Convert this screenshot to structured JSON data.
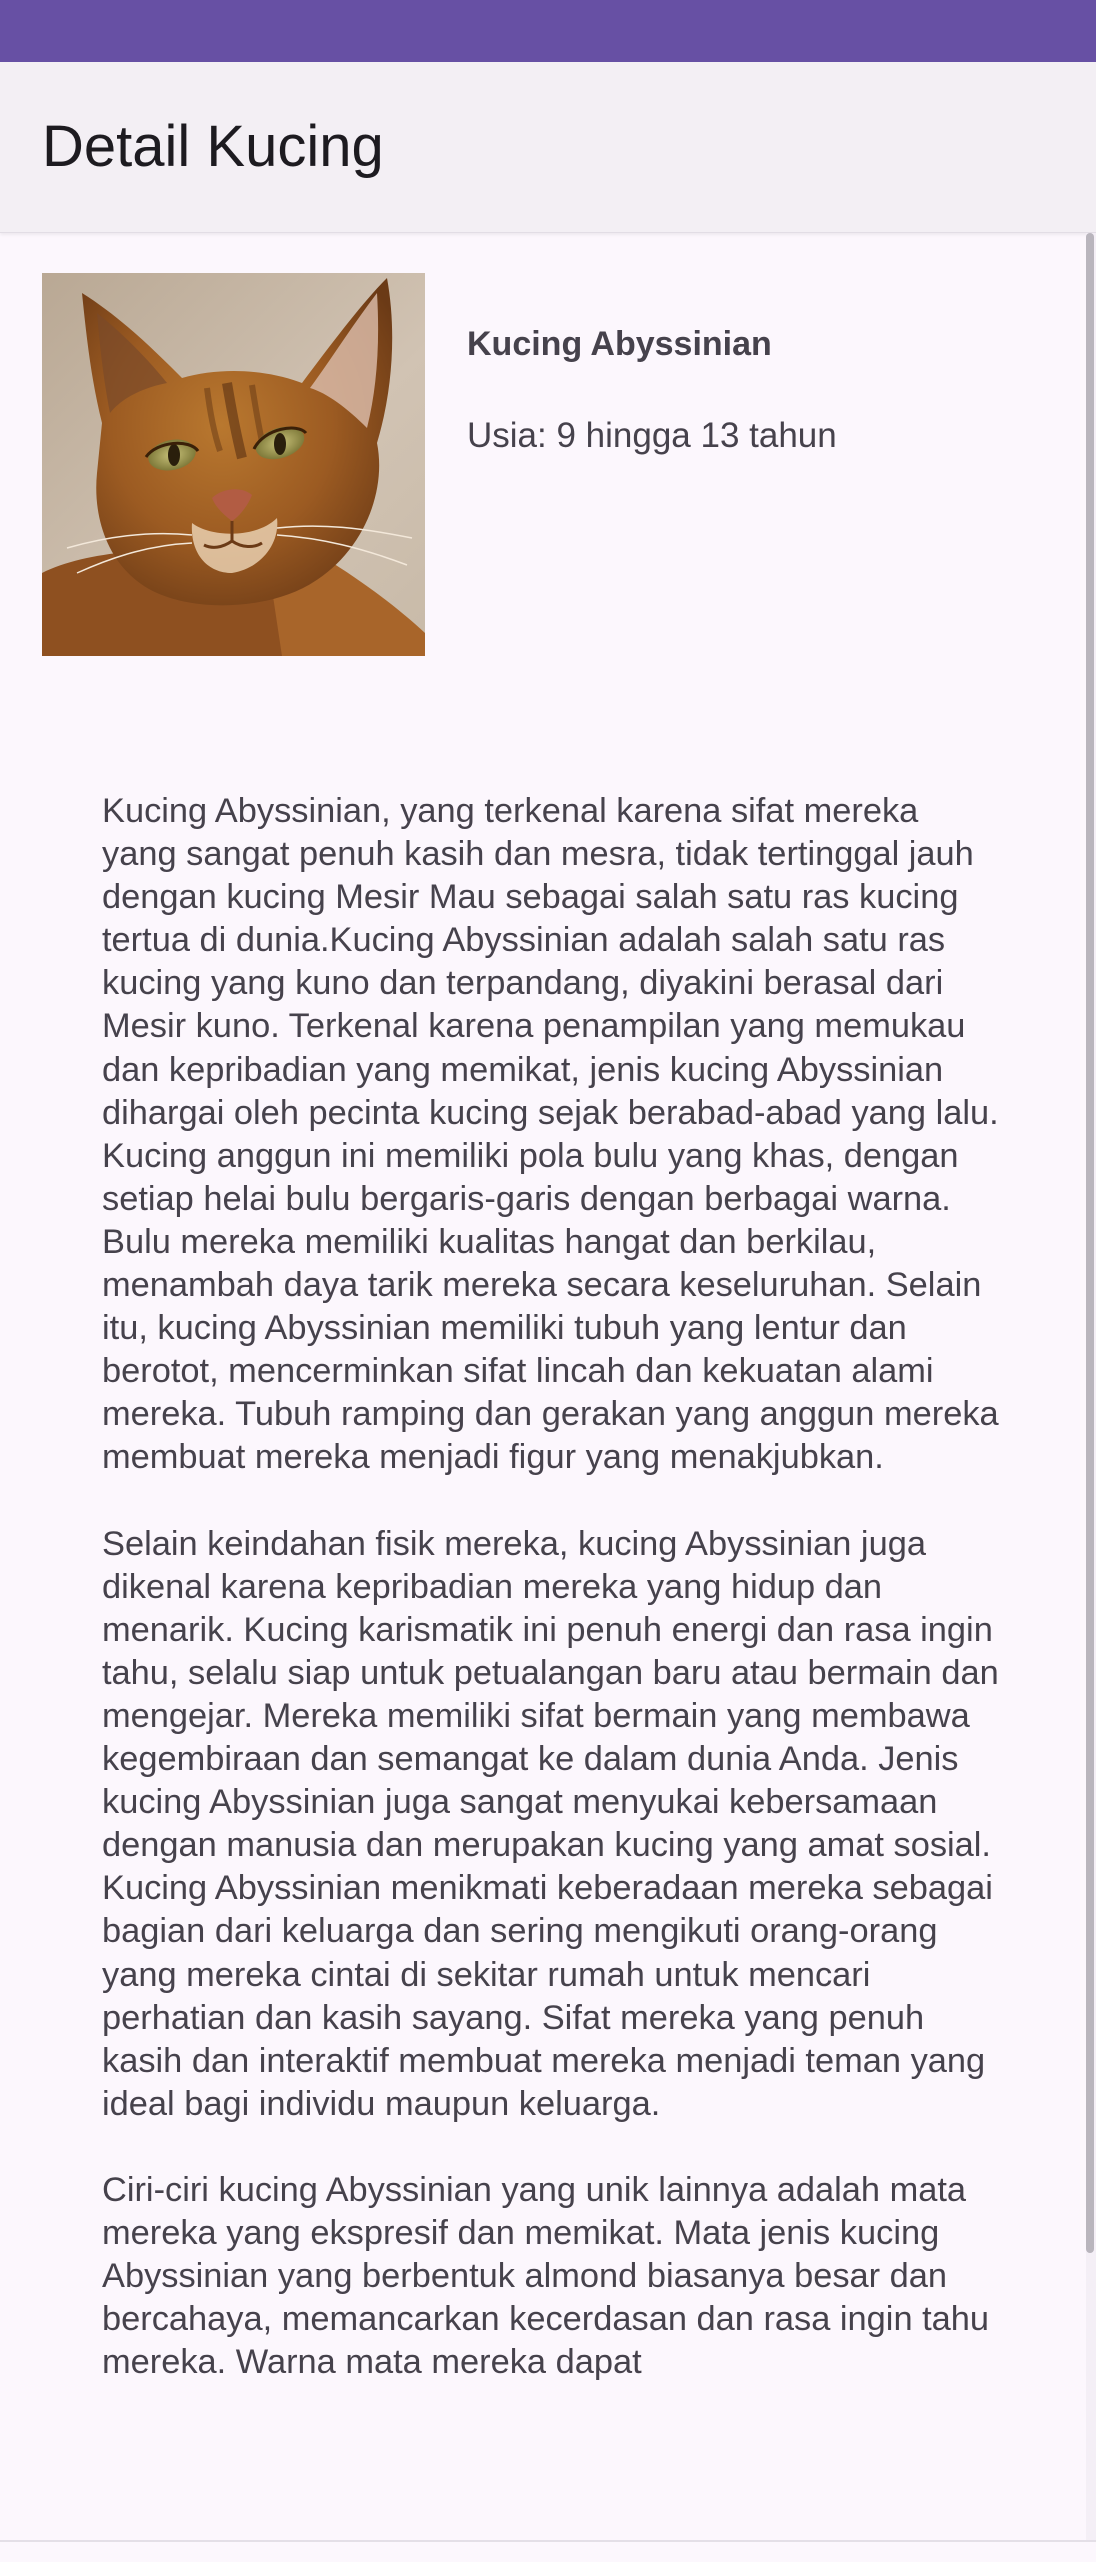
{
  "colors": {
    "status_bar": "#6750a4",
    "app_bar": "#f3eff4",
    "background": "#fcf7fd",
    "text": "#46424c"
  },
  "app_bar": {
    "title": "Detail Kucing"
  },
  "cat": {
    "image_icon": "abyssinian-cat-photo",
    "name": "Kucing Abyssinian",
    "age": "Usia: 9 hingga 13 tahun"
  },
  "description": {
    "paragraphs": [
      "Kucing Abyssinian, yang terkenal karena sifat mereka yang sangat penuh kasih dan mesra, tidak tertinggal jauh dengan kucing Mesir Mau sebagai salah satu ras kucing tertua di dunia.Kucing Abyssinian adalah salah satu ras kucing yang kuno dan terpandang, diyakini berasal dari Mesir kuno. Terkenal karena penampilan yang memukau dan kepribadian yang memikat, jenis kucing Abyssinian dihargai oleh pecinta kucing sejak berabad-abad yang lalu. Kucing anggun ini memiliki pola bulu yang khas, dengan setiap helai bulu bergaris-garis dengan berbagai warna. Bulu mereka memiliki kualitas hangat dan berkilau, menambah daya tarik mereka secara keseluruhan. Selain itu, kucing Abyssinian memiliki tubuh yang lentur dan berotot, mencerminkan sifat lincah dan kekuatan alami mereka. Tubuh ramping dan gerakan yang anggun mereka membuat mereka menjadi figur yang menakjubkan.",
      "Selain keindahan fisik mereka, kucing Abyssinian juga dikenal karena kepribadian mereka yang hidup dan menarik. Kucing karismatik ini penuh energi dan rasa ingin tahu, selalu siap untuk petualangan baru atau bermain dan mengejar. Mereka memiliki sifat bermain yang membawa kegembiraan dan semangat ke dalam dunia Anda. Jenis kucing Abyssinian juga sangat menyukai kebersamaan dengan manusia dan merupakan kucing yang amat sosial. Kucing Abyssinian menikmati keberadaan mereka sebagai bagian dari keluarga dan sering mengikuti orang-orang yang mereka cintai di sekitar rumah untuk mencari perhatian dan kasih sayang. Sifat mereka yang penuh kasih dan interaktif membuat mereka menjadi teman yang ideal bagi individu maupun keluarga.",
      "Ciri-ciri kucing Abyssinian yang unik lainnya adalah mata mereka yang ekspresif dan memikat. Mata jenis kucing Abyssinian yang berbentuk almond biasanya besar dan bercahaya, memancarkan kecerdasan dan rasa ingin tahu mereka. Warna mata mereka dapat"
    ]
  }
}
